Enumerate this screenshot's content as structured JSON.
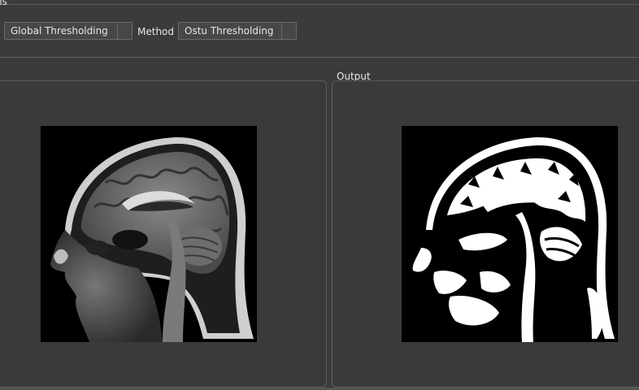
{
  "options": {
    "group_title": "ns",
    "type_combo_value": "Global Thresholding",
    "method_label": "Method",
    "method_combo_value": "Ostu Thresholding"
  },
  "output": {
    "group_title": "Output"
  },
  "colors": {
    "background": "#3b3b3b",
    "border": "#5e5e5e",
    "image_bg": "#000000",
    "threshold_white": "#ffffff"
  }
}
